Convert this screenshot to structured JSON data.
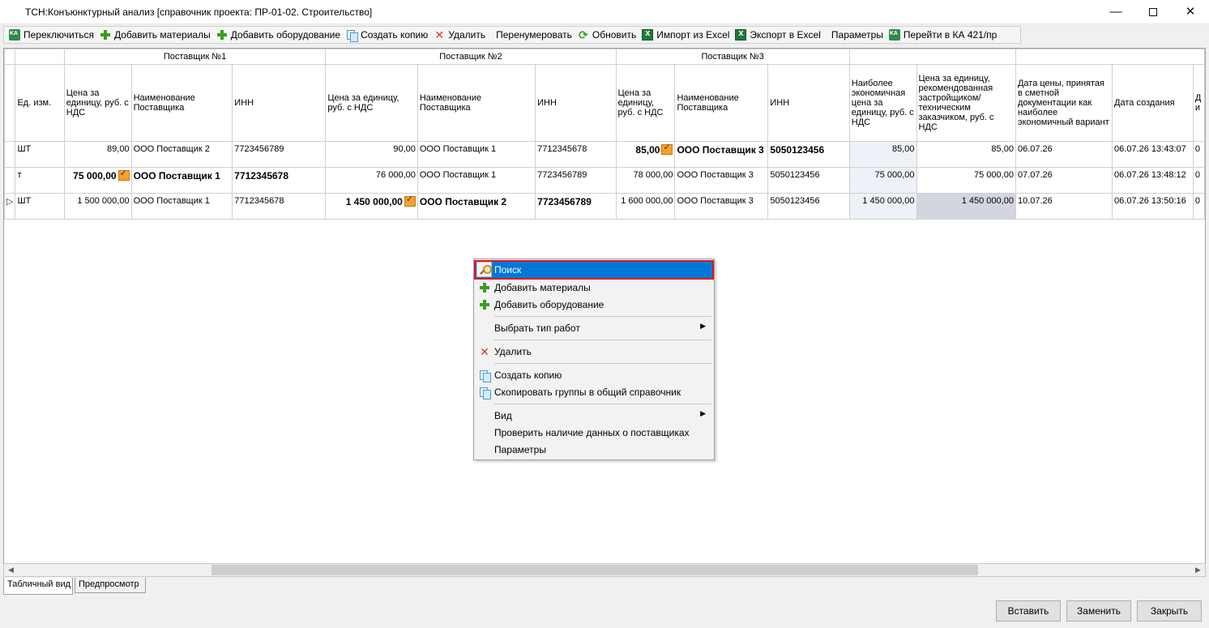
{
  "window": {
    "title": "ТСН:Конъюнктурный анализ [справочник проекта: ПР-01-02. Строительство]",
    "min_glyph": "—",
    "close_glyph": "✕"
  },
  "toolbar": [
    {
      "icon": "ka-icon",
      "label": "Переключиться"
    },
    {
      "icon": "plus-icon",
      "label": "Добавить материалы"
    },
    {
      "icon": "plus-icon",
      "label": "Добавить оборудование"
    },
    {
      "icon": "copy-icon",
      "label": "Создать копию"
    },
    {
      "icon": "delete-icon",
      "label": "Удалить"
    },
    {
      "icon": "",
      "label": "Перенумеровать"
    },
    {
      "icon": "refresh-icon",
      "label": "Обновить"
    },
    {
      "icon": "excel-icon",
      "label": "Импорт из Excel"
    },
    {
      "icon": "excel-icon",
      "label": "Экспорт в Excel"
    },
    {
      "icon": "",
      "label": "Параметры"
    },
    {
      "icon": "ka-icon",
      "label": "Перейти в КА 421/пр"
    }
  ],
  "grid": {
    "groups": [
      "Поставщик №1",
      "Поставщик №2",
      "Поставщик №3"
    ],
    "columns": [
      "Ед. изм.",
      "Цена за единицу, руб. с НДС",
      "Наименование Поставщика",
      "ИНН",
      "Цена за единицу, руб. с НДС",
      "Наименование Поставщика",
      "ИНН",
      "Цена за единицу, руб. с НДС",
      "Наименование Поставщика",
      "ИНН",
      "Наиболее экономичная цена за единицу, руб. с НДС",
      "Цена за единицу, рекомендованная застройщиком/ техническим заказчиком, руб. с НДС",
      "Дата цены, принятая в сметной документации как наиболее экономичный вариант",
      "Дата создания",
      "Д и"
    ],
    "rows": [
      {
        "unit": "ШТ",
        "p1_price": "89,00",
        "p1_name": "ООО Поставщик 2",
        "p1_inn": "7723456789",
        "p2_price": "90,00",
        "p2_name": "ООО Поставщик 1",
        "p2_inn": "7712345678",
        "p3_price": "85,00",
        "p3_name": "ООО Поставщик 3",
        "p3_inn": "5050123456",
        "best": "85,00",
        "recommended": "85,00",
        "price_date": "06.07.26",
        "created": "06.07.26 13:43:07",
        "extra": "0"
      },
      {
        "unit": "т",
        "p1_price": "75 000,00",
        "p1_name": "ООО Поставщик 1",
        "p1_inn": "7712345678",
        "p2_price": "76 000,00",
        "p2_name": "ООО Поставщик 1",
        "p2_inn": "7723456789",
        "p3_price": "78 000,00",
        "p3_name": "ООО Поставщик 3",
        "p3_inn": "5050123456",
        "best": "75 000,00",
        "recommended": "75 000,00",
        "price_date": "07.07.26",
        "created": "06.07.26 13:48:12",
        "extra": "0"
      },
      {
        "unit": "ШТ",
        "p1_price": "1 500 000,00",
        "p1_name": "ООО Поставщик 1",
        "p1_inn": "7712345678",
        "p2_price": "1 450 000,00",
        "p2_name": "ООО Поставщик 2",
        "p2_inn": "7723456789",
        "p3_price": "1 600 000,00",
        "p3_name": "ООО Поставщик 3",
        "p3_inn": "5050123456",
        "best": "1 450 000,00",
        "recommended": "1 450 000,00",
        "price_date": "10.07.26",
        "created": "06.07.26 13:50:16",
        "extra": "0"
      }
    ],
    "row_indicator": "▷"
  },
  "tabs": [
    "Табличный вид",
    "Предпросмотр"
  ],
  "buttons": {
    "insert": "Вставить",
    "replace": "Заменить",
    "close": "Закрыть"
  },
  "context_menu": [
    {
      "icon": "search-icon",
      "label": "Поиск",
      "highlighted": true
    },
    {
      "icon": "plus-icon",
      "label": "Добавить материалы"
    },
    {
      "icon": "plus-icon",
      "label": "Добавить оборудование"
    },
    {
      "icon": "",
      "label": "Выбрать тип работ",
      "submenu": true
    },
    {
      "icon": "delete-icon",
      "label": "Удалить"
    },
    {
      "icon": "copy-icon",
      "label": "Создать копию"
    },
    {
      "icon": "copy-icon",
      "label": "Скопировать группы в общий справочник"
    },
    {
      "icon": "",
      "label": "Вид",
      "submenu": true
    },
    {
      "icon": "",
      "label": "Проверить наличие данных о поставщиках"
    },
    {
      "icon": "",
      "label": "Параметры"
    }
  ],
  "colors": {
    "highlight": "#0078d7",
    "highlight_border": "#e8101a",
    "selected_cell": "#d3d6e0"
  }
}
